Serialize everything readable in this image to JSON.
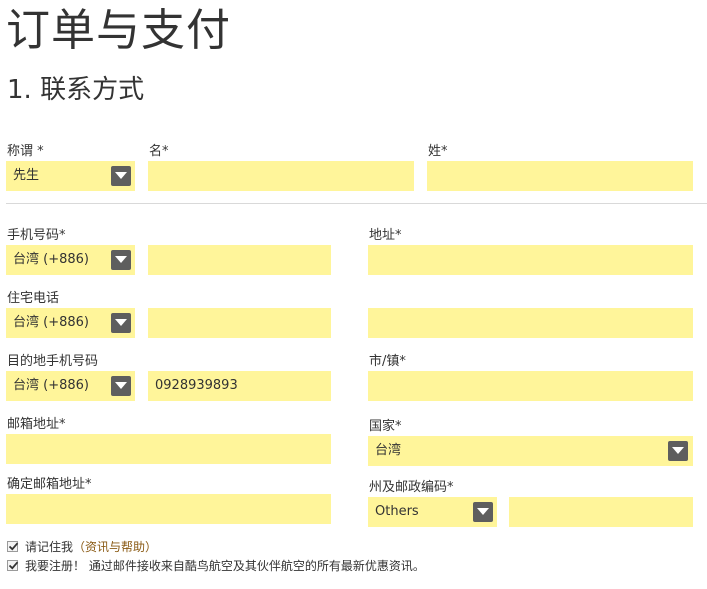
{
  "page": {
    "title": "订单与支付"
  },
  "section": {
    "number": "1.",
    "title": "联系方式"
  },
  "form": {
    "salutation": {
      "label": "称谓 *",
      "value": "先生"
    },
    "first_name": {
      "label": "名*",
      "value": ""
    },
    "last_name": {
      "label": "姓*",
      "value": ""
    },
    "mobile": {
      "label": "手机号码*",
      "country_code": "台湾 (+886)",
      "value": ""
    },
    "home_phone": {
      "label": "住宅电话",
      "country_code": "台湾 (+886)",
      "value": ""
    },
    "destination_mobile": {
      "label": "目的地手机号码",
      "country_code": "台湾 (+886)",
      "value": "0928939893"
    },
    "email": {
      "label": "邮箱地址*",
      "value": ""
    },
    "confirm_email": {
      "label": "确定邮箱地址*",
      "value": ""
    },
    "address": {
      "label": "地址*",
      "line1": "",
      "line2": ""
    },
    "city": {
      "label": "市/镇*",
      "value": ""
    },
    "country": {
      "label": "国家*",
      "value": "台湾"
    },
    "state_postal": {
      "label": "州及邮政编码*",
      "state": "Others",
      "postal": ""
    }
  },
  "options": {
    "remember_me": {
      "label": "请记住我",
      "link": "（资讯与帮助）",
      "checked": true
    },
    "signup": {
      "label": "我要注册！ 通过邮件接收来自酷鸟航空及其伙伴航空的所有最新优惠资讯。",
      "checked": true
    }
  },
  "colors": {
    "field_bg": "#fff59a",
    "caret_bg": "#5e5e5e",
    "link": "#8a5a14",
    "text": "#333333"
  }
}
